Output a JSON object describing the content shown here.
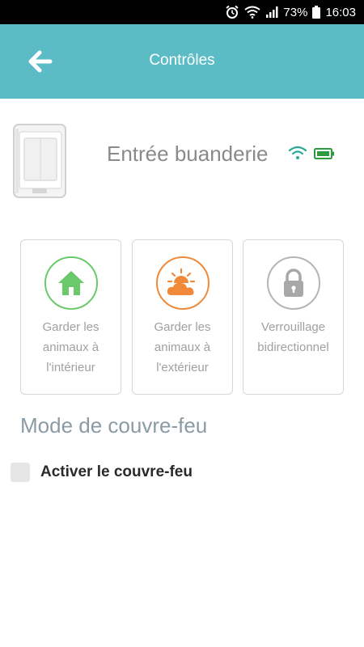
{
  "status_bar": {
    "battery_percent": "73%",
    "time": "16:03",
    "icons": [
      "alarm-icon",
      "wifi-icon",
      "signal-icon",
      "battery-icon"
    ]
  },
  "app_bar": {
    "title": "Contrôles",
    "back_icon": "arrow-left-icon",
    "background_color": "#5bbcc6"
  },
  "device": {
    "name": "Entrée buanderie",
    "image": "pet-door-icon",
    "wifi_color": "#2aa89a",
    "battery_color": "#2e9b3e"
  },
  "modes": [
    {
      "label": "Garder les animaux à l'intérieur",
      "icon": "house-icon",
      "color": "#6cc96b"
    },
    {
      "label": "Garder les animaux à l'extérieur",
      "icon": "sun-cloud-icon",
      "color": "#f08a3a"
    },
    {
      "label": "Verrouillage bidirectionnel",
      "icon": "padlock-icon",
      "color": "#b5b5b5"
    }
  ],
  "curfew": {
    "section_title": "Mode de couvre-feu",
    "checkbox_label": "Activer le couvre-feu",
    "checked": false
  }
}
